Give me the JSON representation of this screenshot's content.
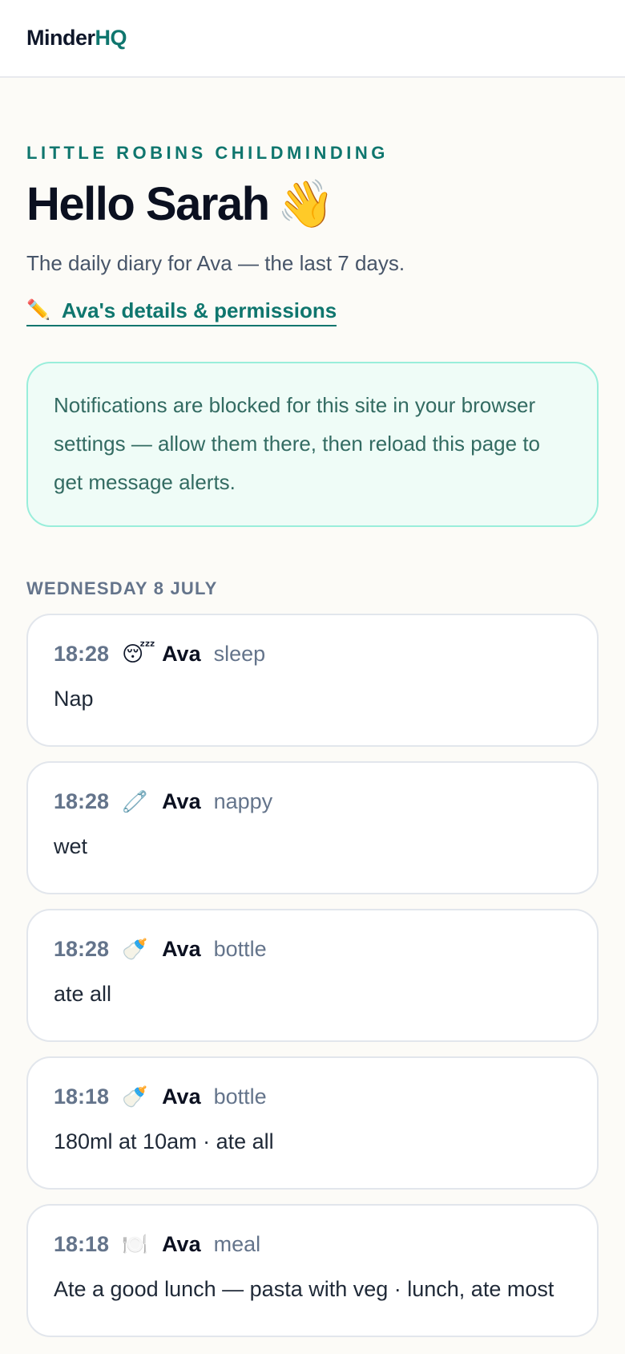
{
  "brand": {
    "name_main": "Minder",
    "name_accent": "HQ"
  },
  "header": {
    "eyebrow": "LITTLE ROBINS CHILDMINDING",
    "greeting": "Hello Sarah",
    "greeting_emoji": "👋",
    "subtitle": "The daily diary for Ava — the last 7 days.",
    "details_link_icon": "✏️",
    "details_link_label": "Ava's details & permissions"
  },
  "notice": {
    "text": "Notifications are blocked for this site in your browser settings — allow them there, then reload this page to get message alerts."
  },
  "day": {
    "label": "WEDNESDAY 8 JULY",
    "entries": [
      {
        "time": "18:28",
        "icon": "😴",
        "icon_name": "sleep-icon",
        "child": "Ava",
        "kind": "sleep",
        "note": "Nap"
      },
      {
        "time": "18:28",
        "icon": "🧷",
        "icon_name": "nappy-icon",
        "child": "Ava",
        "kind": "nappy",
        "note": "wet"
      },
      {
        "time": "18:28",
        "icon": "🍼",
        "icon_name": "bottle-icon",
        "child": "Ava",
        "kind": "bottle",
        "note": "ate all"
      },
      {
        "time": "18:18",
        "icon": "🍼",
        "icon_name": "bottle-icon",
        "child": "Ava",
        "kind": "bottle",
        "note": "180ml at 10am · ate all"
      },
      {
        "time": "18:18",
        "icon": "🍽️",
        "icon_name": "meal-icon",
        "child": "Ava",
        "kind": "meal",
        "note": "Ate a good lunch — pasta with veg · lunch, ate most"
      }
    ]
  },
  "colors": {
    "accent": "#0f766e",
    "background": "#fcfbf7",
    "notice_bg": "#effcf7",
    "notice_border": "#99eedb"
  }
}
